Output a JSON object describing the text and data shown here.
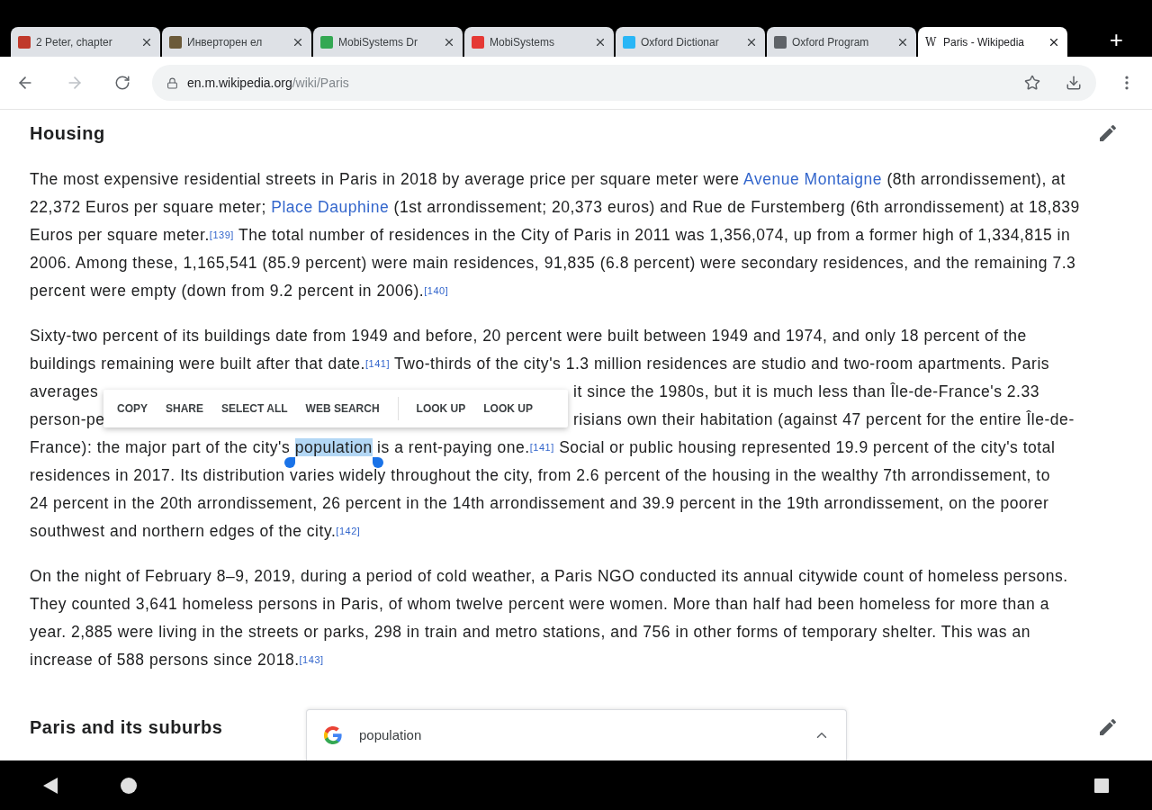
{
  "tabs": [
    {
      "title": "2 Peter, chapter",
      "selected": false,
      "color": "#c0392b"
    },
    {
      "title": "Инверторен ел",
      "selected": false,
      "color": "#6b5a3a"
    },
    {
      "title": "MobiSystems Dr",
      "selected": false,
      "color": "#34a853"
    },
    {
      "title": "MobiSystems",
      "selected": false,
      "color": "#e53935"
    },
    {
      "title": "Oxford Dictionar",
      "selected": false,
      "color": "#29b6f6"
    },
    {
      "title": "Oxford Program",
      "selected": false,
      "color": "#5f6368"
    },
    {
      "title": "Paris - Wikipedia",
      "selected": true,
      "favicon_letter": "W"
    }
  ],
  "new_tab": "+",
  "address": {
    "domain": "en.m.wikipedia.org",
    "path": "/wiki/Paris"
  },
  "sections": [
    {
      "heading": "Housing",
      "paragraphs": [
        [
          {
            "kind": "full",
            "segments": [
              {
                "kind": "text",
                "text": "The most expensive residential streets in Paris in 2018 by average price per square meter were "
              },
              {
                "kind": "link",
                "text": "Avenue Montaigne"
              },
              {
                "kind": "text",
                "text": " (8th arrondissement), at"
              }
            ]
          },
          {
            "kind": "full",
            "segments": [
              {
                "kind": "text",
                "text": "22,372 Euros per square meter; "
              },
              {
                "kind": "link",
                "text": "Place Dauphine"
              },
              {
                "kind": "text",
                "text": " (1st arrondissement; 20,373 euros) and Rue de Furstemberg (6th arrondissement) at 18,839"
              }
            ]
          },
          {
            "kind": "full",
            "segments": [
              {
                "kind": "text",
                "text": "Euros per square meter."
              },
              {
                "kind": "ref",
                "text": "[139]"
              },
              {
                "kind": "text",
                "text": " The total number of residences in the City of Paris in 2011 was 1,356,074, up from a former high of 1,334,815 in"
              }
            ]
          },
          {
            "kind": "full",
            "segments": [
              {
                "kind": "text",
                "text": "2006. Among these, 1,165,541 (85.9 percent) were main residences, 91,835 (6.8 percent) were secondary residences, and the remaining 7.3"
              }
            ]
          },
          {
            "kind": "full",
            "segments": [
              {
                "kind": "text",
                "text": "percent were empty (down from 9.2 percent in 2006)."
              },
              {
                "kind": "ref",
                "text": "[140]"
              }
            ]
          }
        ],
        [
          {
            "kind": "full",
            "segments": [
              {
                "kind": "text",
                "text": "Sixty-two percent of its buildings date from 1949 and before, 20 percent were built between 1949 and 1974, and only 18 percent of the"
              }
            ]
          },
          {
            "kind": "full",
            "segments": [
              {
                "kind": "text",
                "text": "buildings remaining were built after that date."
              },
              {
                "kind": "ref",
                "text": "[141]"
              },
              {
                "kind": "text",
                "text": " Two-thirds of the city's 1.3 million residences are studio and two-room apartments. Paris"
              }
            ]
          },
          {
            "kind": "split",
            "left": "averages",
            "right": "it since the 1980s, but it is much less than Île-de-France's 2.33"
          },
          {
            "kind": "split",
            "left": "person-pe",
            "right": "risians own their habitation (against 47 percent for the entire Île-de-"
          },
          {
            "kind": "full",
            "segments": [
              {
                "kind": "text",
                "text": "France): the major part of the city's "
              },
              {
                "kind": "selected",
                "text": "population"
              },
              {
                "kind": "text",
                "text": " is a rent-paying one."
              },
              {
                "kind": "ref",
                "text": "[141]"
              },
              {
                "kind": "text",
                "text": " Social or public housing represented 19.9 percent of the city's total"
              }
            ]
          },
          {
            "kind": "full",
            "segments": [
              {
                "kind": "text",
                "text": "residences in 2017. Its distribution varies widely throughout the city, from 2.6 percent of the housing in the wealthy 7th arrondissement, to"
              }
            ]
          },
          {
            "kind": "full",
            "segments": [
              {
                "kind": "text",
                "text": "24 percent in the 20th arrondissement, 26 percent in the 14th arrondissement and 39.9 percent in the 19th arrondissement, on the poorer"
              }
            ]
          },
          {
            "kind": "full",
            "segments": [
              {
                "kind": "text",
                "text": "southwest and northern edges of the city."
              },
              {
                "kind": "ref",
                "text": "[142]"
              }
            ]
          }
        ],
        [
          {
            "kind": "full",
            "segments": [
              {
                "kind": "text",
                "text": "On the night of February 8–9, 2019, during a period of cold weather, a Paris NGO conducted its annual citywide count of homeless persons."
              }
            ]
          },
          {
            "kind": "full",
            "segments": [
              {
                "kind": "text",
                "text": "They counted 3,641 homeless persons in Paris, of whom twelve percent were women. More than half had been homeless for more than a"
              }
            ]
          },
          {
            "kind": "full",
            "segments": [
              {
                "kind": "text",
                "text": "year. 2,885 were living in the streets or parks, 298 in train and metro stations, and 756 in other forms of temporary shelter. This was an"
              }
            ]
          },
          {
            "kind": "full",
            "segments": [
              {
                "kind": "text",
                "text": "increase of 588 persons since 2018."
              },
              {
                "kind": "ref",
                "text": "[143]"
              }
            ]
          }
        ]
      ]
    },
    {
      "heading": "Paris and its suburbs"
    }
  ],
  "selection_menu": {
    "actions": [
      "COPY",
      "SHARE",
      "SELECT ALL",
      "WEB SEARCH"
    ],
    "lookup_actions": [
      "LOOK UP",
      "LOOK UP"
    ]
  },
  "search_sheet": {
    "query": "population"
  }
}
